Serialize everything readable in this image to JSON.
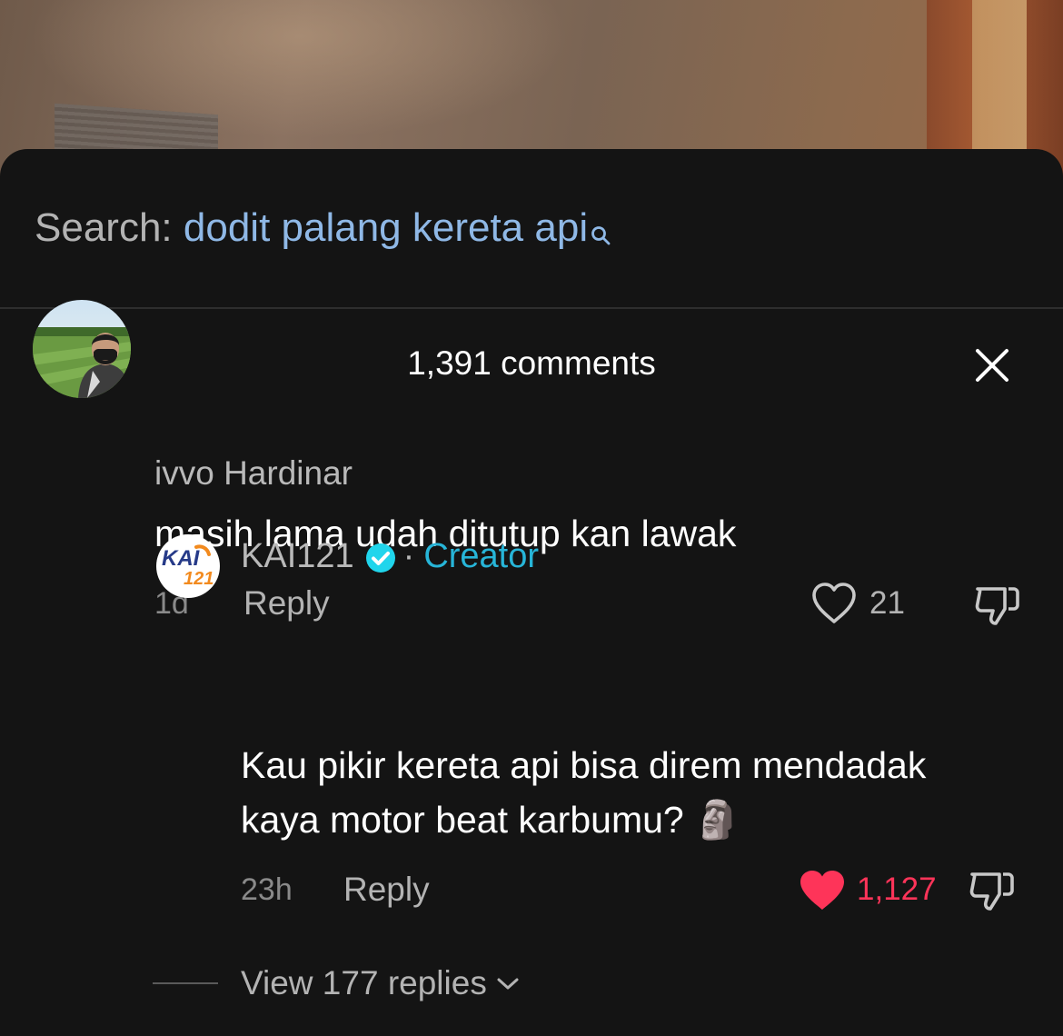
{
  "search": {
    "label": "Search:",
    "query": "dodit palang kereta api"
  },
  "header": {
    "comment_count": "1,391 comments"
  },
  "comments": [
    {
      "username": "ivvo Hardinar",
      "text": "masih lama udah ditutup kan lawak",
      "time": "1d",
      "reply_label": "Reply",
      "likes": "21",
      "liked": false
    }
  ],
  "replies": [
    {
      "username": "KAI121",
      "badge_separator": "·",
      "badge": "Creator",
      "text_line1": "Kau pikir kereta api bisa direm mendadak",
      "text_line2": "kaya motor beat karbumu? 🗿",
      "time": "23h",
      "reply_label": "Reply",
      "likes": "1,127",
      "liked": true,
      "avatar_logo": {
        "top": "KAI",
        "bottom": "121"
      }
    }
  ],
  "view_replies": "View 177 replies",
  "colors": {
    "accent_link": "#8fb8e6",
    "creator": "#27b5d8",
    "liked_heart": "#fe3459",
    "verified": "#20d5ec"
  }
}
